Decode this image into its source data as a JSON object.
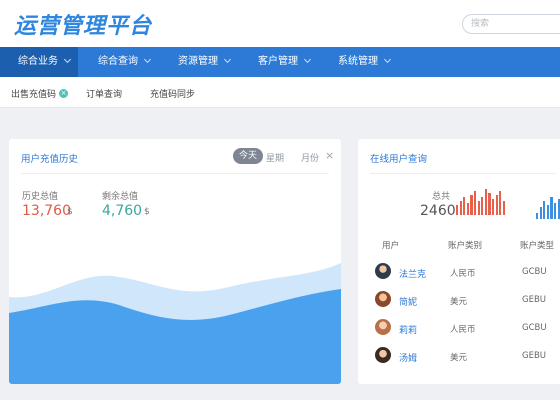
{
  "app": {
    "title": "运营管理平台"
  },
  "search": {
    "placeholder": "搜索"
  },
  "nav": {
    "items": [
      {
        "label": "综合业务",
        "active": true
      },
      {
        "label": "综合查询",
        "active": false
      },
      {
        "label": "资源管理",
        "active": false
      },
      {
        "label": "客户管理",
        "active": false
      },
      {
        "label": "系统管理",
        "active": false
      }
    ]
  },
  "subnav": {
    "items": [
      {
        "label": "出售充值码",
        "closable": true
      },
      {
        "label": "订单查询"
      },
      {
        "label": "充值码同步"
      }
    ]
  },
  "recharge": {
    "title": "用户充值历史",
    "tabs": [
      "今天",
      "星期",
      "月份"
    ],
    "active_tab": "今天",
    "stats": [
      {
        "label": "历史总值",
        "value": "13,760",
        "unit": "$"
      },
      {
        "label": "剩余总值",
        "value": "4,760",
        "unit": "$"
      }
    ]
  },
  "online": {
    "title": "在线用户查询",
    "total_label": "总共",
    "total_value": "2460",
    "columns": [
      "用户",
      "账户类别",
      "账户类型"
    ],
    "rows": [
      {
        "name": "法兰克",
        "category": "人民币",
        "type": "GCBU"
      },
      {
        "name": "简妮",
        "category": "美元",
        "type": "GEBU"
      },
      {
        "name": "莉莉",
        "category": "人民币",
        "type": "GCBU"
      },
      {
        "name": "汤姆",
        "category": "美元",
        "type": "GEBU"
      }
    ]
  },
  "colors": {
    "brand_blue": "#2c7ad6",
    "active_nav": "#1d5faf",
    "stat_red": "#e05a47",
    "stat_teal": "#39a79a",
    "spark_red": "#e6604c",
    "spark_blue": "#3e8fde"
  },
  "icons": {
    "tab_close": "close-icon",
    "subnav_close": "close-circle-icon",
    "nav_dropdown": "chevron-down-icon"
  }
}
